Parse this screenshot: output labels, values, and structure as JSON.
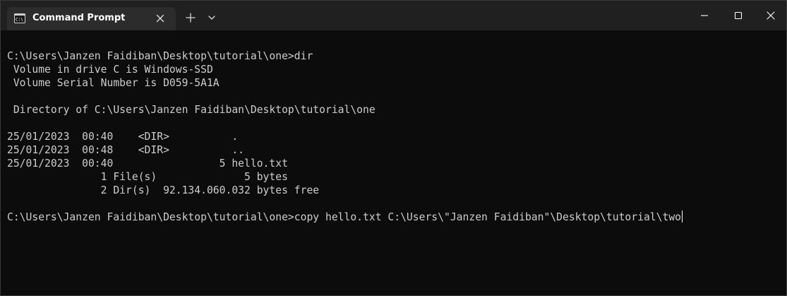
{
  "tab": {
    "title": "Command Prompt",
    "icon": "command-prompt-icon"
  },
  "titlebar_icons": {
    "tab_close": "close-icon",
    "new_tab": "plus-icon",
    "dropdown": "chevron-down-icon",
    "minimize": "minimize-icon",
    "maximize": "maximize-icon",
    "close": "close-icon"
  },
  "colors": {
    "background": "#0c0c0c",
    "titlebar": "#202020",
    "tab": "#2c2c2c",
    "text": "#cccccc"
  },
  "console": {
    "lines": [
      "C:\\Users\\Janzen Faidiban\\Desktop\\tutorial\\one>dir",
      " Volume in drive C is Windows-SSD",
      " Volume Serial Number is D059-5A1A",
      "",
      " Directory of C:\\Users\\Janzen Faidiban\\Desktop\\tutorial\\one",
      "",
      "25/01/2023  00:40    <DIR>          .",
      "25/01/2023  00:48    <DIR>          ..",
      "25/01/2023  00:40                 5 hello.txt",
      "               1 File(s)              5 bytes",
      "               2 Dir(s)  92.134.060.032 bytes free",
      ""
    ],
    "current_input": "C:\\Users\\Janzen Faidiban\\Desktop\\tutorial\\one>copy hello.txt C:\\Users\\\"Janzen Faidiban\"\\Desktop\\tutorial\\two"
  }
}
